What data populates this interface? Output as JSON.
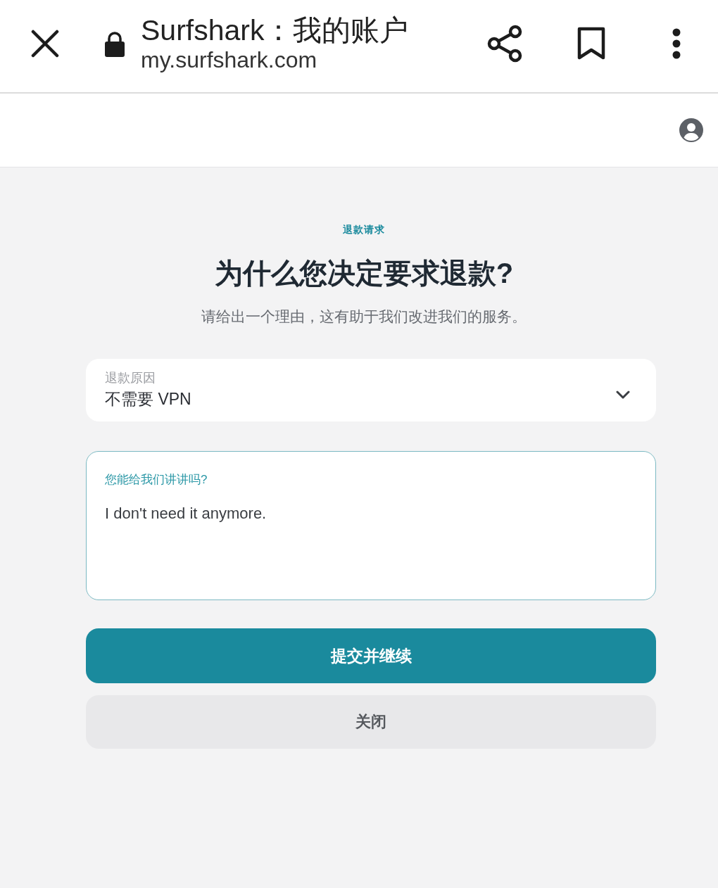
{
  "browser_bar": {
    "title": "Surfshark：我的账户",
    "url": "my.surfshark.com"
  },
  "page": {
    "eyebrow": "退款请求",
    "heading": "为什么您决定要求退款?",
    "subtitle": "请给出一个理由，这有助于我们改进我们的服务。"
  },
  "form": {
    "fields": [
      {
        "kind": "select",
        "label": "退款原因",
        "value": "不需要 VPN",
        "focused": false
      },
      {
        "kind": "textarea",
        "label": "您能给我们讲讲吗?",
        "value": "I don't need it anymore.",
        "focused": true
      }
    ],
    "buttons": [
      {
        "label": "提交并继续",
        "kind": "primary"
      },
      {
        "label": "关闭",
        "kind": "secondary"
      }
    ]
  }
}
